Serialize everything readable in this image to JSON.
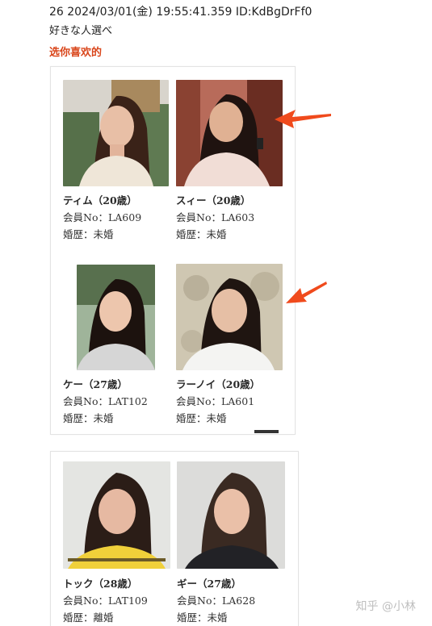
{
  "post": {
    "header": "26 2024/03/01(金) 19:55:41.359 ID:KdBgDrFf0",
    "line2": "好きな人選べ",
    "line3": "选你喜欢的"
  },
  "profiles": [
    {
      "name": "ティム（20歳）",
      "member": "会員No：LA609",
      "marital": "婚歴：未婚"
    },
    {
      "name": "スィー（20歳）",
      "member": "会員No：LA603",
      "marital": "婚歴：未婚"
    },
    {
      "name": "ケー（27歳）",
      "member": "会員No：LAT102",
      "marital": "婚歴：未婚"
    },
    {
      "name": "ラーノイ（20歳）",
      "member": "会員No：LA601",
      "marital": "婚歴：未婚"
    },
    {
      "name": "トック（28歳）",
      "member": "会員No：LAT109",
      "marital": "婚歴：離婚"
    },
    {
      "name": "ギー（27歳）",
      "member": "会員No：LA628",
      "marital": "婚歴：未婚"
    }
  ],
  "watermark": "知乎 @小林",
  "colors": {
    "accent_text": "#d9451a",
    "arrow": "#f04a1c"
  }
}
